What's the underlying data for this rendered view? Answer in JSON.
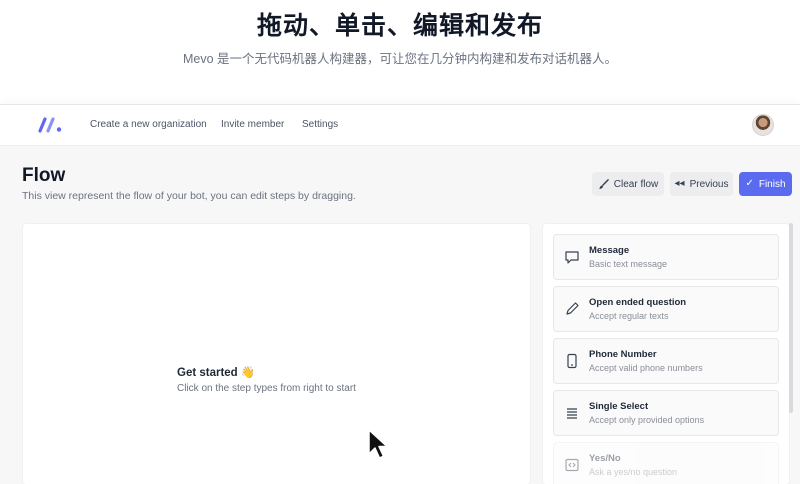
{
  "hero": {
    "title": "拖动、单击、编辑和发布",
    "subtitle": "Mevo 是一个无代码机器人构建器，可让您在几分钟内构建和发布对话机器人。"
  },
  "nav": {
    "links": [
      "Create a new organization",
      "Invite member",
      "Settings"
    ]
  },
  "page": {
    "title": "Flow",
    "description": "This view represent the flow of your bot, you can edit steps by dragging."
  },
  "toolbar": {
    "clear_label": "Clear flow",
    "previous_label": "Previous",
    "finish_label": "Finish"
  },
  "canvas": {
    "title": "Get started 👋",
    "subtitle": "Click on the step types from right to start"
  },
  "steps": [
    {
      "title": "Message",
      "desc": "Basic text message",
      "icon": "chat-bubble-icon"
    },
    {
      "title": "Open ended question",
      "desc": "Accept regular texts",
      "icon": "pencil-icon"
    },
    {
      "title": "Phone Number",
      "desc": "Accept valid phone numbers",
      "icon": "phone-icon"
    },
    {
      "title": "Single Select",
      "desc": "Accept only provided options",
      "icon": "list-icon"
    },
    {
      "title": "Yes/No",
      "desc": "Ask a yes/no question",
      "icon": "code-icon"
    }
  ],
  "colors": {
    "primary": "#5b6bf0",
    "logo": "#6366f1"
  }
}
